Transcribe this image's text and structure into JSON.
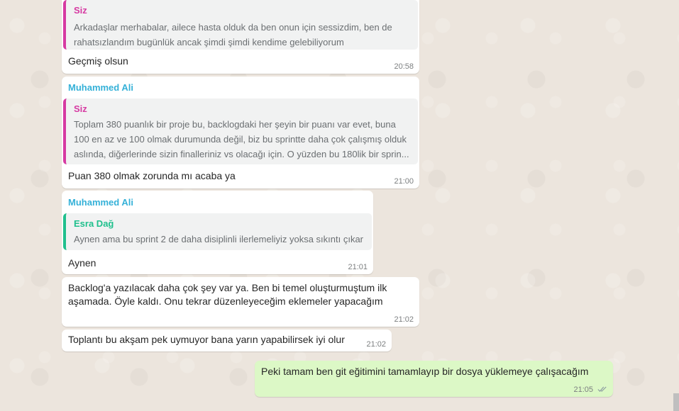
{
  "colors": {
    "you": "#d63aa2",
    "muhammed": "#35b1d8",
    "esra": "#20c08d"
  },
  "m1": {
    "quote_name": "Siz",
    "quote_line1": "Arkadaşlar merhabalar, ailece hasta olduk da ben onun için sessizdim, ben de",
    "quote_line2": "rahatsızlandım bugünlük ancak şimdi şimdi kendime gelebiliyorum",
    "text": "Geçmiş olsun",
    "time": "20:58"
  },
  "m2": {
    "sender": "Muhammed Ali",
    "quote_name": "Siz",
    "quote_line1": "Toplam 380 puanlık bir proje bu, backlogdaki her şeyin bir puanı var evet, buna",
    "quote_line2": "100 en az ve 100 olmak durumunda değil, biz bu sprintte daha çok çalışmış olduk",
    "quote_line3": "aslında, diğerlerinde sizin finalleriniz vs olacağı için. O yüzden bu 180lik bir sprin...",
    "text": "Puan 380 olmak zorunda mı acaba ya",
    "time": "21:00"
  },
  "m3": {
    "sender": "Muhammed Ali",
    "quote_name": "Esra Dağ",
    "quote_line1": "Aynen ama bu sprint 2 de daha disiplinli ilerlemeliyiz yoksa sıkıntı çıkar",
    "text": "Aynen",
    "time": "21:01"
  },
  "m4": {
    "line1": "Backlog'a yazılacak daha çok şey var ya. Ben bi temel oluşturmuştum ilk",
    "line2": "aşamada. Öyle kaldı. Onu tekrar düzenleyeceğim eklemeler yapacağım",
    "time": "21:02"
  },
  "m5": {
    "text": "Toplantı bu akşam pek uymuyor bana yarın yapabilirsek iyi olur",
    "time": "21:02"
  },
  "m6": {
    "text": "Peki tamam ben git eğitimini tamamlayıp bir dosya yüklemeye çalışacağım",
    "time": "21:05",
    "status_icon": "double-check-icon"
  }
}
